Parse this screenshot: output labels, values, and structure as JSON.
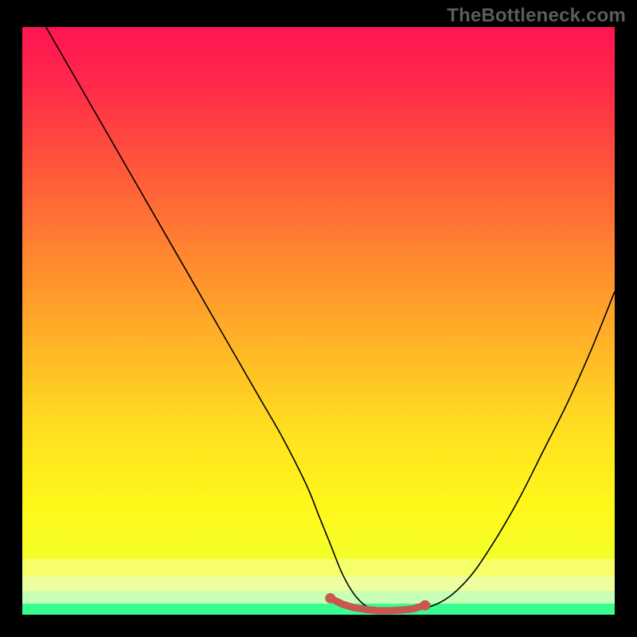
{
  "watermark": {
    "text": "TheBottleneck.com"
  },
  "colors": {
    "frame": "#000000",
    "watermark": "#5c5c5c",
    "curve": "#000000",
    "marker": "#c9564f",
    "gradient_stops": [
      {
        "offset": 0.0,
        "color": "#ff1452"
      },
      {
        "offset": 0.1,
        "color": "#ff2a4a"
      },
      {
        "offset": 0.25,
        "color": "#ff5a3a"
      },
      {
        "offset": 0.4,
        "color": "#ff8a2f"
      },
      {
        "offset": 0.55,
        "color": "#ffb726"
      },
      {
        "offset": 0.7,
        "color": "#ffe31f"
      },
      {
        "offset": 0.82,
        "color": "#fff81a"
      },
      {
        "offset": 0.9,
        "color": "#f4ff2a"
      },
      {
        "offset": 1.0,
        "color": "#f4ff2a"
      }
    ],
    "bottom_bands": [
      {
        "y_frac": 0.905,
        "h_frac": 0.03,
        "color": "#f6ff6a"
      },
      {
        "y_frac": 0.935,
        "h_frac": 0.024,
        "color": "#eeffa0"
      },
      {
        "y_frac": 0.959,
        "h_frac": 0.022,
        "color": "#c9ffb4"
      },
      {
        "y_frac": 0.981,
        "h_frac": 0.019,
        "color": "#36ff8f"
      }
    ]
  },
  "chart_data": {
    "type": "line",
    "title": "",
    "xlabel": "",
    "ylabel": "",
    "xlim": [
      0,
      100
    ],
    "ylim": [
      0,
      100
    ],
    "grid": false,
    "legend": false,
    "series": [
      {
        "name": "curve",
        "x": [
          4,
          8,
          12,
          16,
          20,
          24,
          28,
          32,
          36,
          40,
          44,
          48,
          50,
          52,
          54,
          56,
          58,
          60,
          62,
          64,
          68,
          72,
          76,
          80,
          84,
          88,
          92,
          96,
          100
        ],
        "y": [
          100,
          93,
          86,
          79,
          72,
          65,
          58,
          51,
          44,
          37,
          30,
          22,
          17,
          12,
          7,
          3.5,
          1.5,
          0.8,
          0.6,
          0.7,
          1.1,
          3,
          7,
          13,
          20,
          28,
          36,
          45,
          55
        ]
      }
    ],
    "marker_band": {
      "type": "line",
      "x": [
        52,
        54,
        56,
        58,
        60,
        62,
        64,
        66,
        68
      ],
      "y": [
        2.8,
        1.8,
        1.2,
        0.9,
        0.7,
        0.7,
        0.8,
        1.0,
        1.6
      ],
      "style": "thick-dots",
      "color": "#c9564f"
    }
  }
}
